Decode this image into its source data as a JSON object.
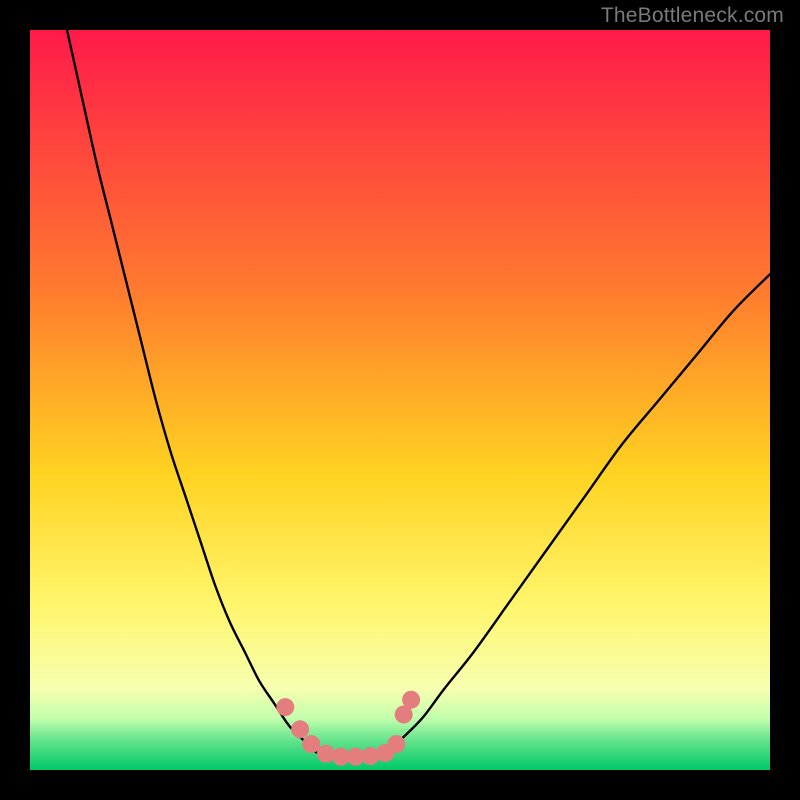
{
  "watermark": "TheBottleneck.com",
  "chart_data": {
    "type": "line",
    "title": "",
    "xlabel": "",
    "ylabel": "",
    "xlim": [
      0,
      100
    ],
    "ylim": [
      0,
      100
    ],
    "grid": false,
    "legend": false,
    "background": {
      "type": "vertical-gradient",
      "stops": [
        {
          "pos": 0,
          "color": "#ff1a4a"
        },
        {
          "pos": 35,
          "color": "#ff7a2e"
        },
        {
          "pos": 60,
          "color": "#ffd321"
        },
        {
          "pos": 78,
          "color": "#fff66e"
        },
        {
          "pos": 89,
          "color": "#f7ffb0"
        },
        {
          "pos": 93,
          "color": "#c3ffad"
        },
        {
          "pos": 96,
          "color": "#63e38c"
        },
        {
          "pos": 100,
          "color": "#00c968"
        }
      ]
    },
    "series": [
      {
        "name": "left-curve",
        "x": [
          5,
          7,
          9,
          11,
          13,
          15,
          17,
          19,
          21,
          23,
          25,
          27,
          29,
          31,
          33,
          35,
          37,
          38.5,
          40
        ],
        "y": [
          100,
          91,
          82,
          74,
          66,
          58,
          50,
          43,
          37,
          31,
          25,
          20,
          16,
          12,
          9,
          6,
          4,
          2.5,
          2
        ]
      },
      {
        "name": "valley-floor",
        "x": [
          40,
          42,
          44,
          46,
          48
        ],
        "y": [
          2,
          1.5,
          1.5,
          1.5,
          2
        ]
      },
      {
        "name": "right-curve",
        "x": [
          48,
          50,
          53,
          56,
          60,
          65,
          70,
          75,
          80,
          85,
          90,
          95,
          100
        ],
        "y": [
          2,
          4,
          7,
          11,
          16,
          23,
          30,
          37,
          44,
          50,
          56,
          62,
          67
        ]
      }
    ],
    "markers": [
      {
        "x": 34.5,
        "y": 8.5
      },
      {
        "x": 36.5,
        "y": 5.5
      },
      {
        "x": 38,
        "y": 3.5
      },
      {
        "x": 40,
        "y": 2.2
      },
      {
        "x": 42,
        "y": 1.8
      },
      {
        "x": 44,
        "y": 1.8
      },
      {
        "x": 46,
        "y": 1.9
      },
      {
        "x": 48,
        "y": 2.3
      },
      {
        "x": 49.5,
        "y": 3.5
      },
      {
        "x": 50.5,
        "y": 7.5
      },
      {
        "x": 51.5,
        "y": 9.5
      }
    ],
    "marker_style": {
      "color": "#e47d7d",
      "radius_px": 9
    }
  }
}
